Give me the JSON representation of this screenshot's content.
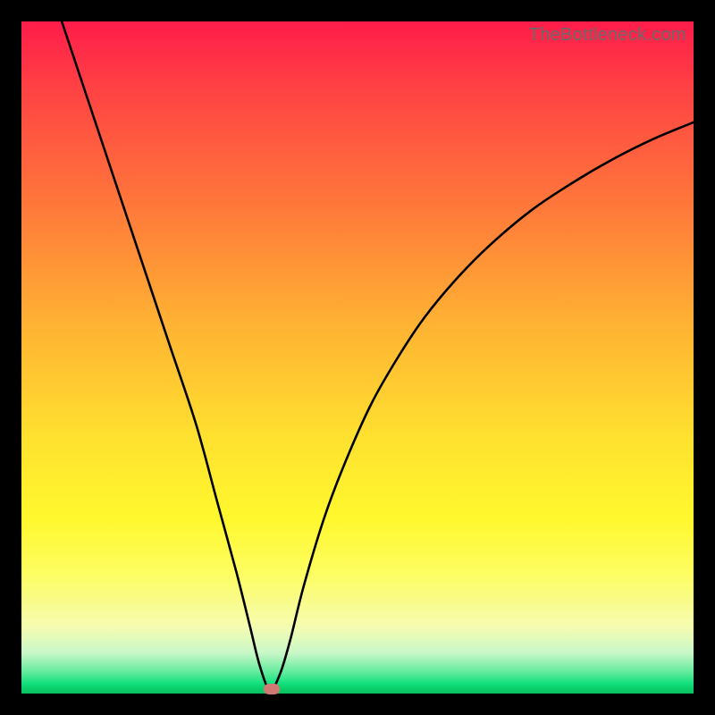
{
  "watermark": "TheBottleneck.com",
  "colors": {
    "curve": "#000000",
    "dot": "#cf7a73",
    "frame": "#000000"
  },
  "chart_data": {
    "type": "line",
    "title": "",
    "xlabel": "",
    "ylabel": "",
    "xlim": [
      0,
      100
    ],
    "ylim": [
      0,
      100
    ],
    "grid": false,
    "legend": false,
    "note": "V-shaped bottleneck curve; minimum near x≈37. Values are estimated from pixel positions (no axis ticks in source image).",
    "series": [
      {
        "name": "bottleneck",
        "x": [
          6,
          10,
          14,
          18,
          22,
          26,
          29,
          32,
          34,
          35.5,
          37,
          38.5,
          40,
          42,
          45,
          48,
          52,
          56,
          60,
          65,
          70,
          76,
          82,
          88,
          94,
          100
        ],
        "y": [
          100,
          88,
          76,
          64,
          52,
          40,
          29,
          18,
          10,
          4,
          0.5,
          3,
          8,
          16,
          26,
          34,
          43,
          50,
          56,
          62,
          67,
          72,
          76,
          79.5,
          82.5,
          85
        ]
      }
    ],
    "marker": {
      "x": 37.2,
      "y": 0.6
    }
  }
}
